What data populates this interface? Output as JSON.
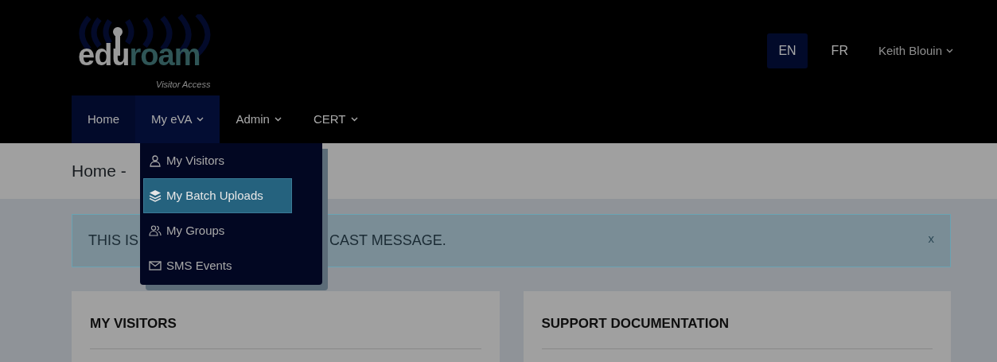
{
  "logo": {
    "word_parts": [
      "edu",
      "roam"
    ],
    "subtitle": "Visitor Access"
  },
  "languages": [
    {
      "label": "EN",
      "selected": true
    },
    {
      "label": "FR",
      "selected": false
    }
  ],
  "user_menu": {
    "label": "Keith Blouin"
  },
  "nav": [
    {
      "label": "Home",
      "selected": true,
      "dropdown": false,
      "expanded": false
    },
    {
      "label": "My eVA",
      "selected": false,
      "dropdown": true,
      "expanded": true
    },
    {
      "label": "Admin",
      "selected": false,
      "dropdown": true,
      "expanded": false
    },
    {
      "label": "CERT",
      "selected": false,
      "dropdown": true,
      "expanded": false
    }
  ],
  "dropdown_menu": [
    {
      "label": "My Visitors",
      "selected": false
    },
    {
      "label": "My Batch Uploads",
      "selected": true
    },
    {
      "label": "My Groups",
      "selected": false
    },
    {
      "label": "SMS Events",
      "selected": false
    }
  ],
  "breadcrumb": "Home -",
  "alert": {
    "text_parts": [
      "THIS IS",
      "CAST MESSAGE."
    ],
    "close": "x"
  },
  "cards": [
    {
      "title": "MY VISITORS"
    },
    {
      "title": "SUPPORT DOCUMENTATION"
    }
  ]
}
